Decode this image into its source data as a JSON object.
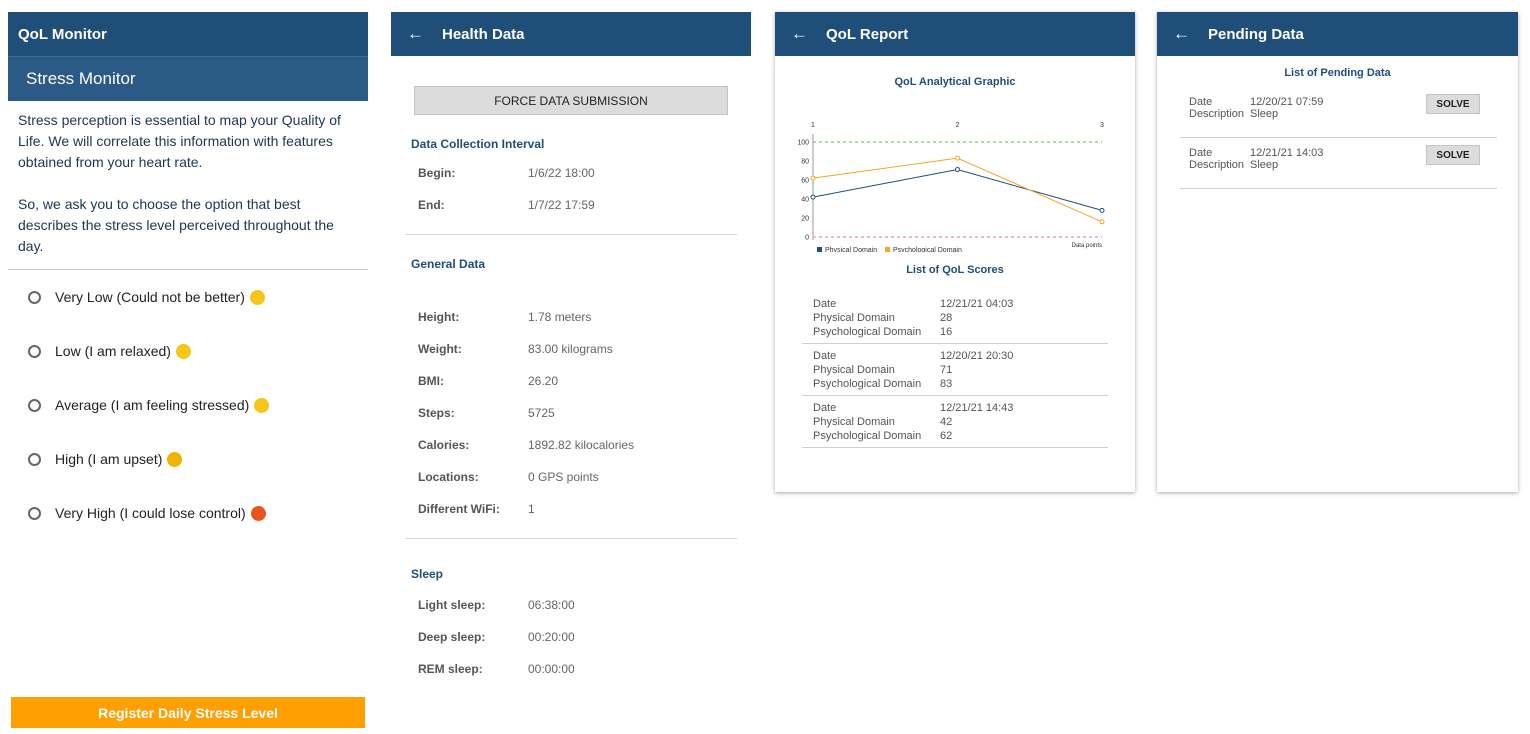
{
  "stress_screen": {
    "title": "QoL Monitor",
    "subtitle": "Stress Monitor",
    "intro": "Stress perception is essential to map your Quality of Life. We will correlate this information with features obtained from your heart rate.",
    "question": "So, we ask you to choose the option that best describes the stress level perceived throughout the day.",
    "options": [
      {
        "label": "Very Low (Could not be better)",
        "emoji": "grinning-face",
        "color": "#f5c518"
      },
      {
        "label": "Low (I am relaxed)",
        "emoji": "relieved-face",
        "color": "#f5c518"
      },
      {
        "label": "Average (I am feeling stressed)",
        "emoji": "downcast-sweat-face",
        "color": "#f5c518"
      },
      {
        "label": "High (I am upset)",
        "emoji": "angry-face",
        "color": "#f0b400"
      },
      {
        "label": "Very High (I could lose control)",
        "emoji": "rage-face",
        "color": "#e8531f"
      }
    ],
    "register_button": "Register Daily Stress Level"
  },
  "health_screen": {
    "title": "Health Data",
    "force_button": "FORCE DATA SUBMISSION",
    "interval_title": "Data Collection Interval",
    "interval": [
      {
        "key": "Begin:",
        "value": "1/6/22 18:00"
      },
      {
        "key": "End:",
        "value": "1/7/22 17:59"
      }
    ],
    "general_title": "General Data",
    "general": [
      {
        "key": "Height:",
        "value": "1.78 meters"
      },
      {
        "key": "Weight:",
        "value": "83.00 kilograms"
      },
      {
        "key": "BMI:",
        "value": "26.20"
      },
      {
        "key": "Steps:",
        "value": "5725"
      },
      {
        "key": "Calories:",
        "value": "1892.82 kilocalories"
      },
      {
        "key": "Locations:",
        "value": "0 GPS points"
      },
      {
        "key": "Different WiFi:",
        "value": "1"
      }
    ],
    "sleep_title": "Sleep",
    "sleep": [
      {
        "key": "Light sleep:",
        "value": "06:38:00"
      },
      {
        "key": "Deep sleep:",
        "value": "00:20:00"
      },
      {
        "key": "REM sleep:",
        "value": "00:00:00"
      }
    ]
  },
  "report_screen": {
    "title": "QoL Report",
    "graphic_title": "QoL Analytical Graphic",
    "scores_title": "List of QoL Scores",
    "labels": {
      "date": "Date",
      "physical": "Physical Domain",
      "psychological": "Psychological Domain"
    },
    "scores": [
      {
        "date": "12/21/21 04:03",
        "physical": "28",
        "psychological": "16"
      },
      {
        "date": "12/20/21 20:30",
        "physical": "71",
        "psychological": "83"
      },
      {
        "date": "12/21/21 14:43",
        "physical": "42",
        "psychological": "62"
      }
    ]
  },
  "pending_screen": {
    "title": "Pending Data",
    "list_title": "List of Pending Data",
    "labels": {
      "date": "Date",
      "description": "Description"
    },
    "solve_label": "SOLVE",
    "items": [
      {
        "date": "12/20/21 07:59",
        "description": "Sleep"
      },
      {
        "date": "12/21/21 14:03",
        "description": "Sleep"
      }
    ]
  },
  "chart_data": {
    "type": "line",
    "x": [
      1,
      2,
      3
    ],
    "xlabel": "Data points",
    "ylabel": "",
    "ylim": [
      0,
      100
    ],
    "yticks": [
      0,
      20,
      40,
      60,
      80,
      100
    ],
    "reference_lines": [
      {
        "value": 100,
        "color": "#8fd08f"
      },
      {
        "value": 0,
        "color": "#f0a0a0"
      }
    ],
    "series": [
      {
        "name": "Physical Domain",
        "color": "#1f4e79",
        "values": [
          42,
          71,
          28
        ]
      },
      {
        "name": "Psychological Domain",
        "color": "#f5a623",
        "values": [
          62,
          83,
          16
        ]
      }
    ],
    "legend": "bottom-left",
    "grid": false
  },
  "colors": {
    "primary": "#1f4e79",
    "accent": "#ffa000"
  }
}
